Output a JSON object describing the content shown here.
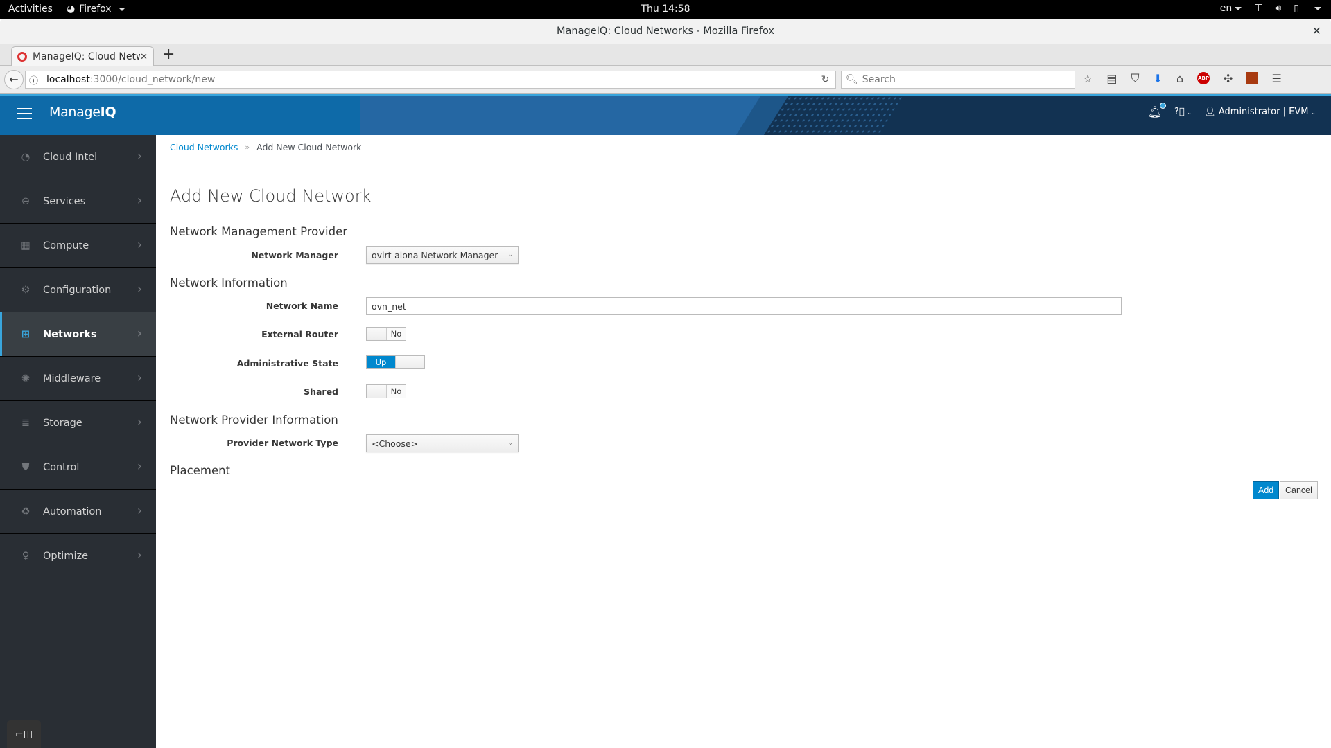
{
  "system_bar": {
    "activities": "Activities",
    "app_menu": "Firefox",
    "clock": "Thu 14:58",
    "language": "en",
    "icons": [
      "network-icon",
      "volume-icon",
      "battery-icon",
      "system-menu-caret-icon"
    ]
  },
  "window": {
    "title": "ManageIQ: Cloud Networks - Mozilla Firefox",
    "close_glyph": "✕"
  },
  "browser": {
    "tabs": [
      {
        "title": "ManageIQ: Cloud Netw",
        "close_glyph": "✕"
      }
    ],
    "new_tab_glyph": "+",
    "url_host": "localhost",
    "url_path": ":3000/cloud_network/new",
    "search_placeholder": "Search",
    "toolbar_icons": [
      "bookmark-star-icon",
      "reading-list-icon",
      "pocket-icon",
      "download-icon",
      "home-icon",
      "adblock-icon",
      "extension-icon",
      "extension-2-icon",
      "menu-icon"
    ],
    "adblock_label": "ABP"
  },
  "app_header": {
    "brand_light": "Manage",
    "brand_bold": "IQ",
    "user_label": "Administrator | EVM",
    "notification_count_shown": true
  },
  "sidebar": {
    "items": [
      {
        "label": "Cloud Intel",
        "icon": "tachometer-icon",
        "active": false
      },
      {
        "label": "Services",
        "icon": "services-icon",
        "active": false
      },
      {
        "label": "Compute",
        "icon": "cpu-icon",
        "active": false
      },
      {
        "label": "Configuration",
        "icon": "gear-icon",
        "active": false
      },
      {
        "label": "Networks",
        "icon": "network-icon",
        "active": true
      },
      {
        "label": "Middleware",
        "icon": "middleware-icon",
        "active": false
      },
      {
        "label": "Storage",
        "icon": "database-icon",
        "active": false
      },
      {
        "label": "Control",
        "icon": "shield-icon",
        "active": false
      },
      {
        "label": "Automation",
        "icon": "recycle-icon",
        "active": false
      },
      {
        "label": "Optimize",
        "icon": "lightbulb-icon",
        "active": false
      }
    ]
  },
  "breadcrumb": {
    "parent": "Cloud Networks",
    "separator": "»",
    "current": "Add New Cloud Network"
  },
  "page": {
    "title": "Add New Cloud Network",
    "sections": {
      "provider": "Network Management Provider",
      "info": "Network Information",
      "provider_info": "Network Provider Information",
      "placement": "Placement"
    },
    "fields": {
      "network_manager": {
        "label": "Network Manager",
        "value": "ovirt-alona Network Manager"
      },
      "network_name": {
        "label": "Network Name",
        "value": "ovn_net"
      },
      "external_router": {
        "label": "External Router",
        "value": "No"
      },
      "admin_state": {
        "label": "Administrative State",
        "value": "Up"
      },
      "shared": {
        "label": "Shared",
        "value": "No"
      },
      "provider_network_type": {
        "label": "Provider Network Type",
        "value": "<Choose>"
      }
    },
    "buttons": {
      "add": "Add",
      "cancel": "Cancel"
    }
  },
  "colors": {
    "primary": "#0088ce",
    "header": "#0e6aa8",
    "sidebar_bg": "#292e34",
    "active_accent": "#39a5dc"
  }
}
